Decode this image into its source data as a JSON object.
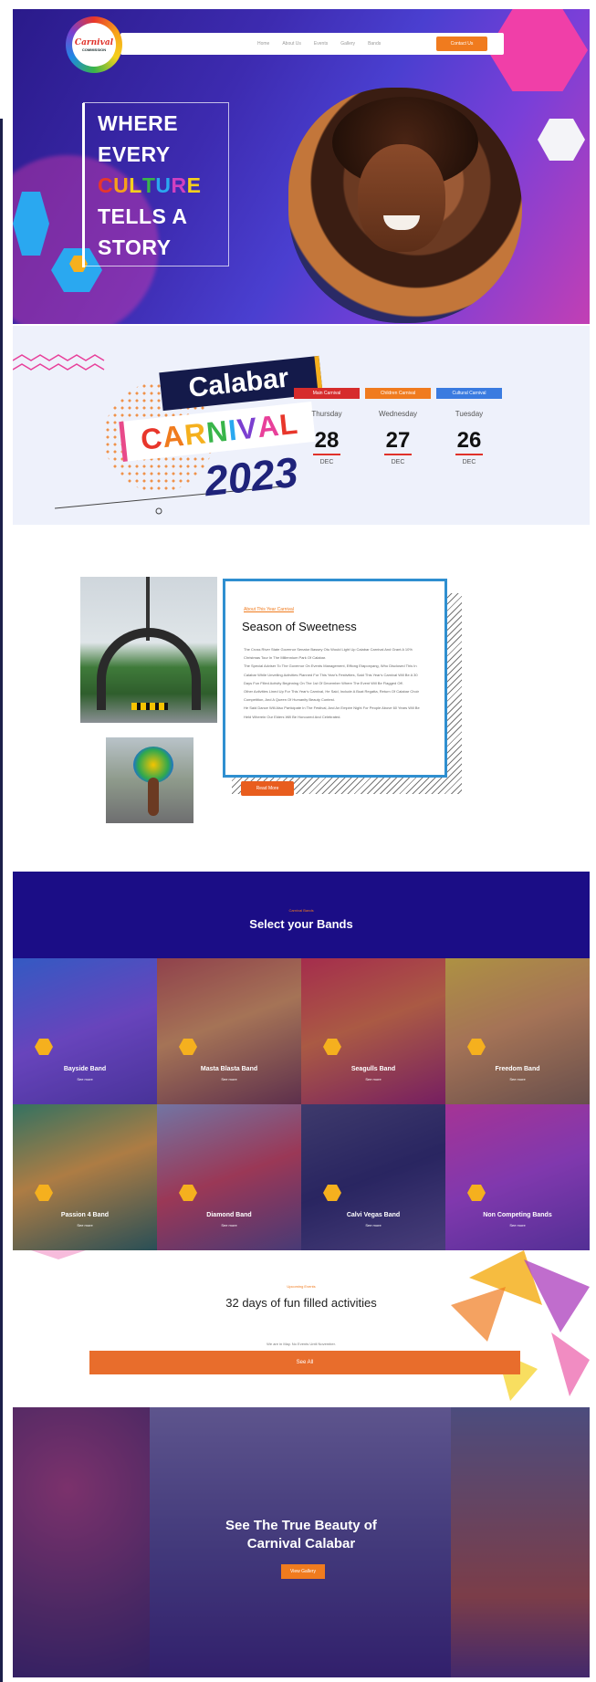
{
  "nav": {
    "logo_text": "Carnival",
    "logo_sub": "COMMISSION",
    "links": [
      "Home",
      "About Us",
      "Events",
      "Gallery",
      "Bands"
    ],
    "cta_label": "Contact Us"
  },
  "hero": {
    "title_lines": [
      "WHERE",
      "EVERY",
      "CULTURE",
      "TELLS A",
      "STORY"
    ]
  },
  "dates": {
    "banner_word1": "Calabar",
    "banner_word2": "CARNIVAL",
    "banner_year": "2023",
    "events": [
      {
        "label": "Main Carnival",
        "day": "Thursday",
        "date": "28",
        "month": "DEC",
        "color": "#d62c2c"
      },
      {
        "label": "Children Carnival",
        "day": "Wednesday",
        "date": "27",
        "month": "DEC",
        "color": "#f07b1e"
      },
      {
        "label": "Cultural Carnival",
        "day": "Tuesday",
        "date": "26",
        "month": "DEC",
        "color": "#3a7be0"
      }
    ]
  },
  "about": {
    "eyebrow": "About This Year Carnival",
    "title": "Season of Sweetness",
    "paragraphs": [
      "The Cross River State Governor Senator Bassey Otu Would Light Up Calabar Carnival And Grant A 10%",
      "Christmas Tour In The Millennium Park Of Calabar.",
      "The Special Adviser To The Governor On Events Management, Effiong Etaponyang, Who Disclosed This In",
      "Calabar While Unveiling Activities Planned For This Year's Festivities, Said This Year's Carnival Will Be A 30",
      "Days Fun Filled Activity Beginning On The 1st Of December Where The Event Will Be Flagged Off.",
      "Other Activities Lined Up For This Year's Carnival, He Said, Include A Boat Regatta, Return Of Calabar Choir",
      "Competition, And A Queen Of Humanity Beauty Contest.",
      "He Said Dance Will Also Participate In The Festival, And An Empire Night For People Above 60 Years Will Be",
      "Held Wherein Our Elders Will Be Honoured And Celebrated."
    ],
    "read_more": "Read More"
  },
  "bands": {
    "eyebrow": "Carnival Bands",
    "title": "Select your Bands",
    "more_label": "See more",
    "items": [
      {
        "name": "Bayside Band",
        "bg": "linear-gradient(160deg,#3a7be0,#8a5ad6 50%,#5a3fa0)"
      },
      {
        "name": "Masta Blasta Band",
        "bg": "linear-gradient(160deg,#c8562a,#e8a23a 45%,#7a3a2a)"
      },
      {
        "name": "Seagulls Band",
        "bg": "linear-gradient(160deg,#e8362b,#f07b1e 45%,#a0204a)"
      },
      {
        "name": "Freedom Band",
        "bg": "linear-gradient(160deg,#f5d01c,#e8a23a 45%,#8a6a2a)"
      },
      {
        "name": "Passion 4 Band",
        "bg": "linear-gradient(160deg,#3aa04a,#f5b01e 45%,#2a6a3a)"
      },
      {
        "name": "Diamond Band",
        "bg": "linear-gradient(160deg,#9aa4b0,#d8473a 50%,#5a4a6a)"
      },
      {
        "name": "Calvi Vegas Band",
        "bg": "linear-gradient(160deg,#4a4a5a,#2a2a4a 50%,#5a5070)"
      },
      {
        "name": "Non Competing Bands",
        "bg": "linear-gradient(160deg,#e8409a,#b048c0 50%,#6a3a9a)"
      }
    ]
  },
  "events": {
    "eyebrow": "Upcoming Events",
    "title": "32 days of fun filled activities",
    "sub": "We are in May. No Events Until November.",
    "button": "See All"
  },
  "gallery": {
    "title_line1": "See The True Beauty of",
    "title_line2": "Carnival Calabar",
    "button": "View Gallery"
  }
}
